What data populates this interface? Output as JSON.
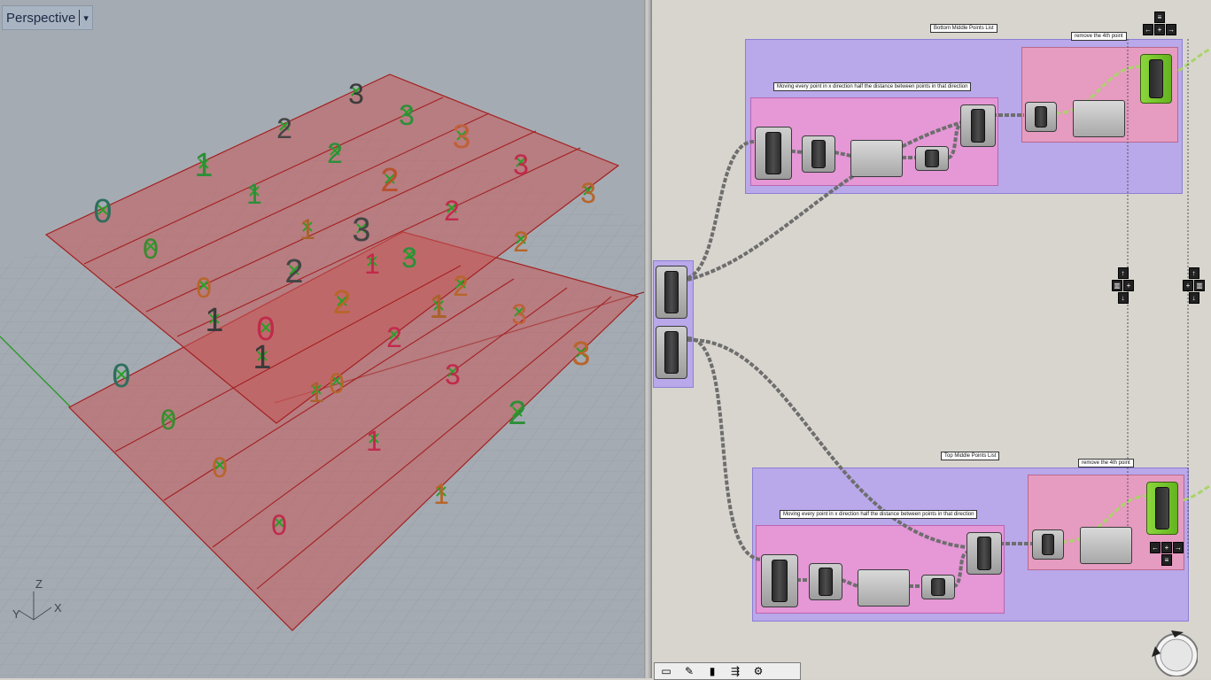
{
  "viewport": {
    "title": "Perspective",
    "dropdown_caret": "▾",
    "axis_labels": {
      "z": "Z",
      "y": "Y",
      "x": "X"
    },
    "point_labels_top_plane": [
      {
        "text": "0",
        "color": "#2e6e5c"
      },
      {
        "text": "0",
        "color": "#3a8a2f"
      },
      {
        "text": "0",
        "color": "#b7652a"
      },
      {
        "text": "1",
        "color": "#2c8f38"
      },
      {
        "text": "1",
        "color": "#2c8f38"
      },
      {
        "text": "1",
        "color": "#a9622a"
      },
      {
        "text": "1",
        "color": "#3a3a3a"
      },
      {
        "text": "2",
        "color": "#444444"
      },
      {
        "text": "2",
        "color": "#2c8f38"
      },
      {
        "text": "2",
        "color": "#b8502e"
      },
      {
        "text": "2",
        "color": "#c12a4a"
      },
      {
        "text": "2",
        "color": "#b8652a"
      },
      {
        "text": "2",
        "color": "#444444"
      },
      {
        "text": "3",
        "color": "#3b3b3b"
      },
      {
        "text": "3",
        "color": "#2c8f38"
      },
      {
        "text": "3",
        "color": "#c0603a"
      },
      {
        "text": "3",
        "color": "#c12a4a"
      },
      {
        "text": "3",
        "color": "#b8652a"
      },
      {
        "text": "3",
        "color": "#444444"
      },
      {
        "text": "3",
        "color": "#2c8f38"
      }
    ],
    "point_labels_bottom_plane": [
      {
        "text": "0",
        "color": "#2e6e5c"
      },
      {
        "text": "0",
        "color": "#3a8a2f"
      },
      {
        "text": "0",
        "color": "#b7652a"
      },
      {
        "text": "0",
        "color": "#c12a4a"
      },
      {
        "text": "0",
        "color": "#b7652a"
      },
      {
        "text": "0",
        "color": "#c12a4a"
      },
      {
        "text": "1",
        "color": "#3a3a3a"
      },
      {
        "text": "1",
        "color": "#a9622a"
      },
      {
        "text": "1",
        "color": "#c12a4a"
      },
      {
        "text": "1",
        "color": "#a9622a"
      },
      {
        "text": "1",
        "color": "#c12a4a"
      },
      {
        "text": "1",
        "color": "#b7652a"
      },
      {
        "text": "2",
        "color": "#b8652a"
      },
      {
        "text": "2",
        "color": "#c12a4a"
      },
      {
        "text": "2",
        "color": "#b8652a"
      },
      {
        "text": "2",
        "color": "#2c8f38"
      },
      {
        "text": "3",
        "color": "#c0603a"
      },
      {
        "text": "3",
        "color": "#c12a4a"
      },
      {
        "text": "3",
        "color": "#b8652a"
      }
    ]
  },
  "canvas": {
    "groups": {
      "top_outer_label": "Bottom Middle Points List",
      "top_inner_label": "Moving every point in x direction half the distance between points in that direction",
      "top_right_label": "remove the 4th point",
      "bottom_outer_label": "Top Middle Points List",
      "bottom_inner_label": "Moving every point in x direction half the distance between points in that direction",
      "bottom_right_label": "remove the 4th point"
    },
    "nav_glyphs": {
      "list": "≡",
      "left": "←",
      "plus": "+",
      "right": "→",
      "up": "↑",
      "down": "↓",
      "pipe": "▥"
    },
    "colors": {
      "group_purple": "#b9a8ea",
      "group_pink": "#e597d6",
      "group_rose": "#e69bc0",
      "wire": "#6e6e6e",
      "green_wire": "#a9d46a",
      "preview_green": "#7fd23a"
    }
  },
  "toolbar": {
    "items": [
      {
        "icon": "select-icon",
        "glyph": "▭"
      },
      {
        "icon": "sketch-icon",
        "glyph": "✎"
      },
      {
        "icon": "preview-icon",
        "glyph": "▮"
      },
      {
        "icon": "wires-icon",
        "glyph": "⇶"
      },
      {
        "icon": "bake-icon",
        "glyph": "⚙"
      }
    ]
  }
}
